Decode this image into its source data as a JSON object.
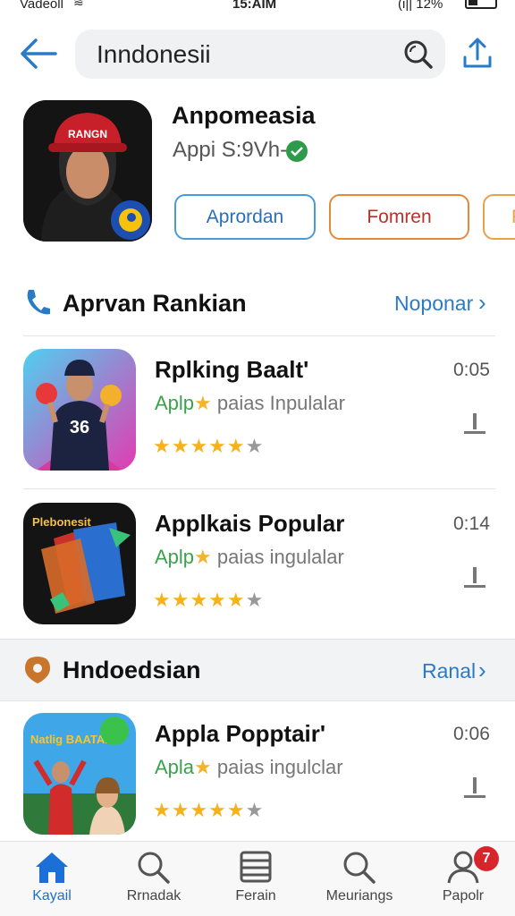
{
  "status": {
    "carrier": "Vadeoll",
    "time": "15:AIM",
    "battery": "(i|| 12%"
  },
  "search": {
    "query": "Inndonesii"
  },
  "featured": {
    "title": "Anpomeasia",
    "subtitle": "Appi S:9Vh-",
    "cap_text": "RANGN",
    "buttons": [
      "Aprordan",
      "Fomren",
      "F"
    ]
  },
  "sections": [
    {
      "title": "Aprvan Rankian",
      "link": "Noponar"
    },
    {
      "title": "Hndoedsian",
      "link": "Ranal"
    }
  ],
  "apps": [
    {
      "name": "Rplking Baalt'",
      "desc_green": "Aplp",
      "desc_rest": " paias Inpulalar",
      "duration": "0:05",
      "jersey": "36",
      "rating": 4
    },
    {
      "name": "Applkais Popular",
      "desc_green": "Aplp",
      "desc_rest": " paias ingulalar",
      "duration": "0:14",
      "icon_text": "Plebonesit",
      "rating": 4
    },
    {
      "name": "Appla Popptair'",
      "desc_green": "Apla",
      "desc_rest": " paias ingulclar",
      "duration": "0:06",
      "icon_text": "Natlig BAATAIVS",
      "rating": 4
    }
  ],
  "tabs": [
    {
      "label": "Kayail",
      "icon": "home-icon",
      "active": true
    },
    {
      "label": "Rrnadak",
      "icon": "search-icon",
      "active": false
    },
    {
      "label": "Ferain",
      "icon": "list-icon",
      "active": false
    },
    {
      "label": "Meuriangs",
      "icon": "search-icon",
      "active": false
    },
    {
      "label": "Papolr",
      "icon": "person-icon",
      "active": false
    }
  ],
  "badge": "7",
  "colors": {
    "accent": "#2a7bc7",
    "green": "#3aa24d",
    "orange": "#e28a3a",
    "star": "#f6b21c",
    "badge": "#d7262b"
  }
}
